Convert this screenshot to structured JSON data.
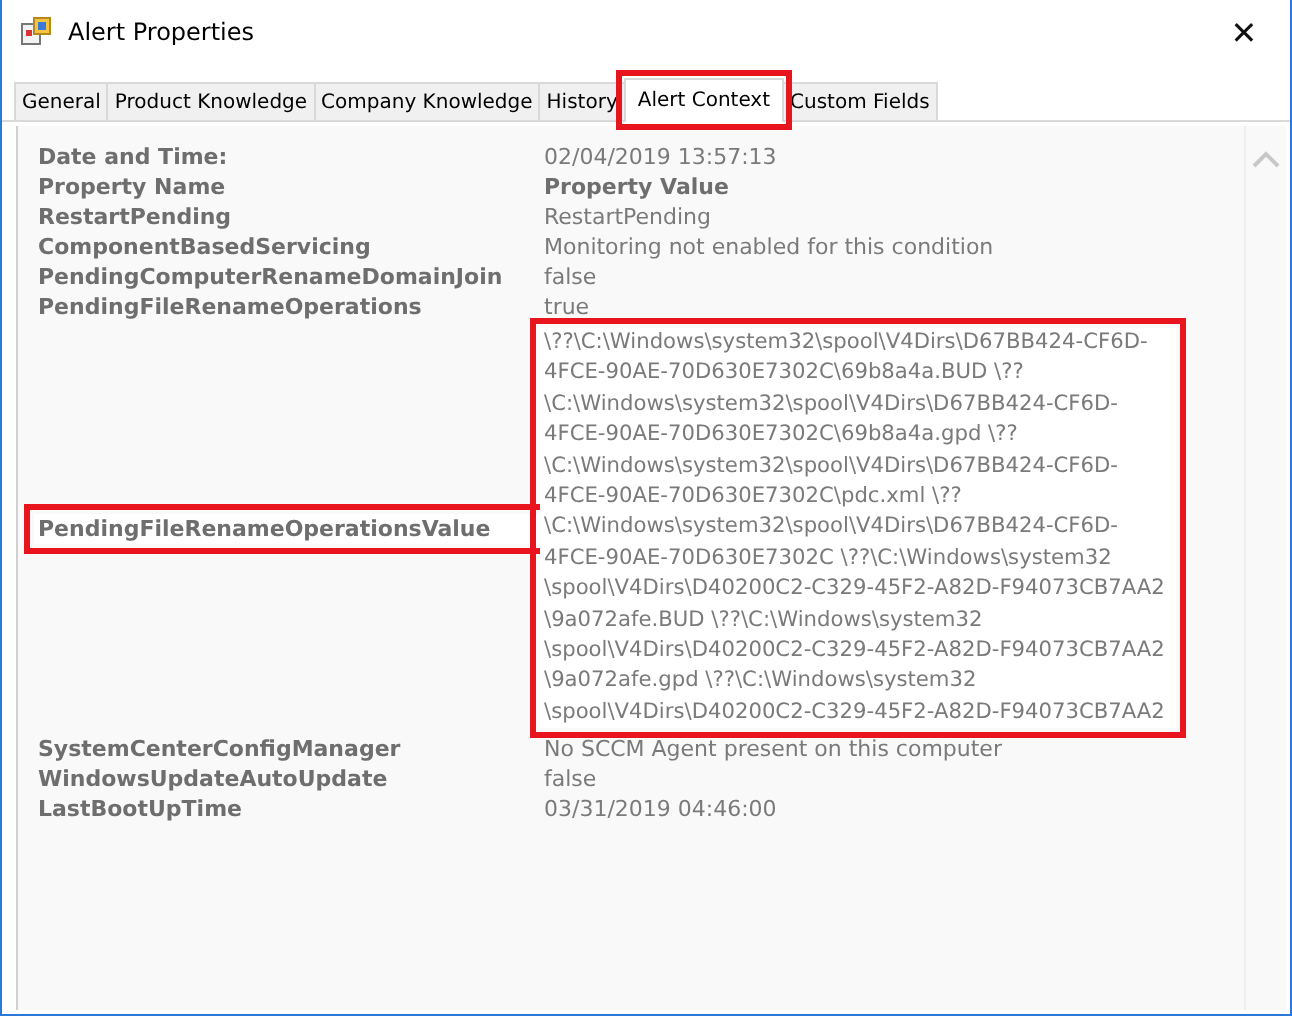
{
  "window": {
    "title": "Alert Properties",
    "close": "✕"
  },
  "tabs": [
    {
      "label": "General",
      "selected": false,
      "highlighted": false
    },
    {
      "label": "Product Knowledge",
      "selected": false,
      "highlighted": false
    },
    {
      "label": "Company Knowledge",
      "selected": false,
      "highlighted": false
    },
    {
      "label": "History",
      "selected": false,
      "highlighted": false
    },
    {
      "label": "Alert Context",
      "selected": true,
      "highlighted": true
    },
    {
      "label": "Custom Fields",
      "selected": false,
      "highlighted": false
    }
  ],
  "rows": [
    {
      "kind": "plain",
      "name": "Date and Time:",
      "value": "02/04/2019 13:57:13",
      "highlighted": false
    },
    {
      "kind": "header",
      "name": "Property Name",
      "value": "Property Value",
      "highlighted": false
    },
    {
      "kind": "plain",
      "name": "RestartPending",
      "value": "RestartPending",
      "highlighted": false
    },
    {
      "kind": "plain",
      "name": "ComponentBasedServicing",
      "value": "Monitoring not enabled for this condition",
      "highlighted": false
    },
    {
      "kind": "plain",
      "name": "PendingComputerRenameDomainJoin",
      "value": "false",
      "highlighted": false
    },
    {
      "kind": "plain",
      "name": "PendingFileRenameOperations",
      "value": "true",
      "highlighted": false
    },
    {
      "kind": "multiline",
      "name": "PendingFileRenameOperationsValue",
      "highlighted": true,
      "value_lines": [
        "\\??\\C:\\Windows\\system32\\spool\\V4Dirs\\D67BB424-CF6D-",
        "4FCE-90AE-70D630E7302C\\69b8a4a.BUD \\??",
        "\\C:\\Windows\\system32\\spool\\V4Dirs\\D67BB424-CF6D-",
        "4FCE-90AE-70D630E7302C\\69b8a4a.gpd \\??",
        "\\C:\\Windows\\system32\\spool\\V4Dirs\\D67BB424-CF6D-",
        "4FCE-90AE-70D630E7302C\\pdc.xml \\??",
        "\\C:\\Windows\\system32\\spool\\V4Dirs\\D67BB424-CF6D-",
        "4FCE-90AE-70D630E7302C \\??\\C:\\Windows\\system32",
        "\\spool\\V4Dirs\\D40200C2-C329-45F2-A82D-F94073CB7AA2",
        "\\9a072afe.BUD \\??\\C:\\Windows\\system32",
        "\\spool\\V4Dirs\\D40200C2-C329-45F2-A82D-F94073CB7AA2",
        "\\9a072afe.gpd \\??\\C:\\Windows\\system32",
        "\\spool\\V4Dirs\\D40200C2-C329-45F2-A82D-F94073CB7AA2"
      ]
    },
    {
      "kind": "plain",
      "name": "SystemCenterConfigManager",
      "value": "No SCCM Agent present on this computer",
      "highlighted": false
    },
    {
      "kind": "plain",
      "name": "WindowsUpdateAutoUpdate",
      "value": "false",
      "highlighted": false
    },
    {
      "kind": "plain",
      "name": "LastBootUpTime",
      "value": "03/31/2019 04:46:00",
      "highlighted": false
    }
  ]
}
